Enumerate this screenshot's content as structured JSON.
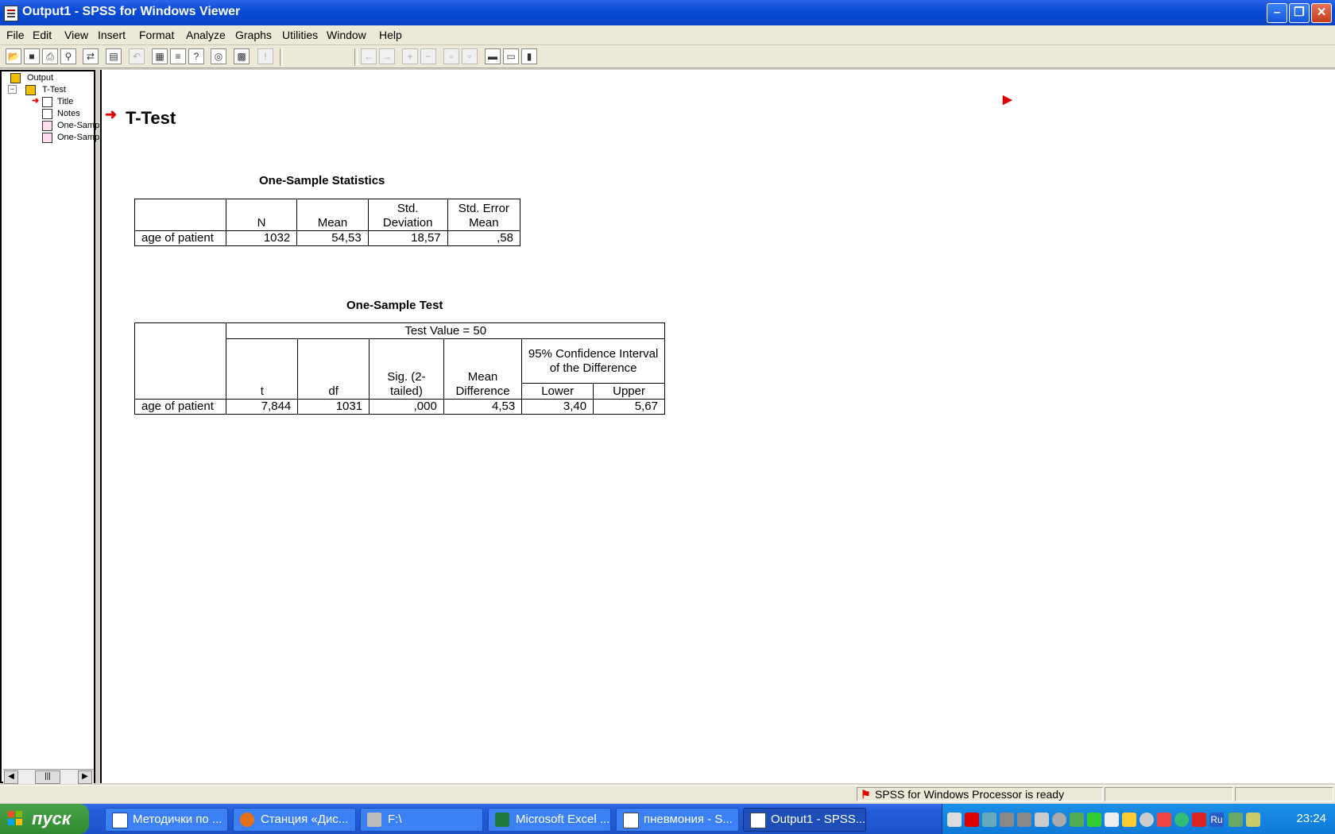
{
  "window": {
    "title": "Output1 - SPSS for Windows Viewer"
  },
  "menu": [
    "File",
    "Edit",
    "View",
    "Insert",
    "Format",
    "Analyze",
    "Graphs",
    "Utilities",
    "Window",
    "Help"
  ],
  "outline": {
    "items": [
      {
        "label": "Output",
        "icon": "book-icon"
      },
      {
        "label": "T-Test",
        "icon": "book-icon"
      },
      {
        "label": "Title",
        "icon": "title-icon"
      },
      {
        "label": "Notes",
        "icon": "notes-icon"
      },
      {
        "label": "One-Samp",
        "icon": "table-icon"
      },
      {
        "label": "One-Samp",
        "icon": "table-icon"
      }
    ]
  },
  "output": {
    "heading": "T-Test",
    "stats_table": {
      "title": "One-Sample Statistics",
      "headers": [
        "N",
        "Mean",
        "Std. Deviation",
        "Std. Error Mean"
      ],
      "row_label": "age of patient",
      "values": [
        "1032",
        "54,53",
        "18,57",
        ",58"
      ]
    },
    "test_table": {
      "title": "One-Sample Test",
      "test_value": "Test Value = 50",
      "headers": [
        "t",
        "df",
        "Sig. (2-tailed)",
        "Mean Difference"
      ],
      "ci_header": "95% Confidence Interval of the Difference",
      "ci_sub": [
        "Lower",
        "Upper"
      ],
      "row_label": "age of patient",
      "values": [
        "7,844",
        "1031",
        ",000",
        "4,53",
        "3,40",
        "5,67"
      ]
    }
  },
  "status": {
    "text": "SPSS for Windows Processor is ready"
  },
  "taskbar": {
    "start": "пуск",
    "tasks": [
      {
        "label": "Методички по ...",
        "icon": "word-icon"
      },
      {
        "label": "Станция «Дис...",
        "icon": "firefox-icon"
      },
      {
        "label": "F:\\",
        "icon": "drive-icon"
      },
      {
        "label": "Microsoft Excel ...",
        "icon": "excel-icon"
      },
      {
        "label": "пневмония - S...",
        "icon": "spss-icon"
      },
      {
        "label": "Output1 - SPSS...",
        "icon": "spss-icon"
      }
    ],
    "tray_lang": "Ru",
    "clock": "23:24"
  },
  "colors": {
    "accent": "#0a4bd6",
    "taskbar": "#245edb",
    "start": "#2f8a2f",
    "pointer": "#e00000"
  }
}
